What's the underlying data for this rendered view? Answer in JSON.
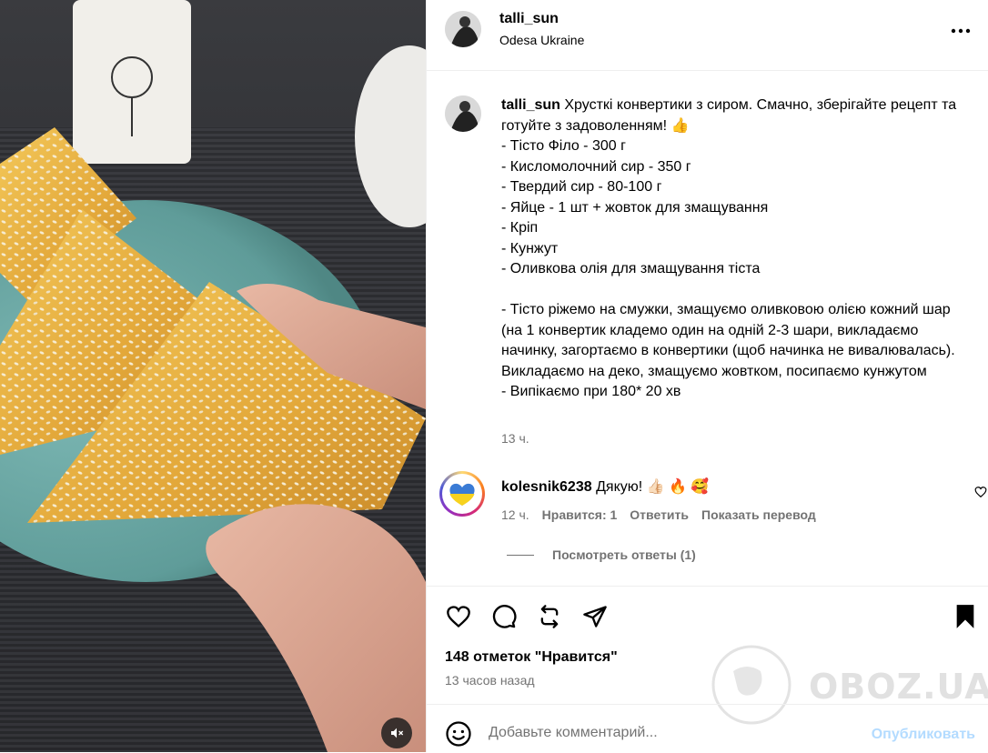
{
  "header": {
    "username": "talli_sun",
    "location": "Odesa Ukraine"
  },
  "caption": {
    "username": "talli_sun",
    "text": "Хрусткі конвертики з сиром. Смачно, зберігайте рецепт та готуйте з задоволенням! 👍\n- Тісто Філо - 300 г\n- Кисломолочний сир - 350 г\n- Твердий сир - 80-100 г\n- Яйце - 1 шт + жовток для змащування\n- Кріп\n- Кунжут\n- Оливкова олія для змащування тіста\n\n- Тісто ріжемо на смужки, змащуємо оливковою олією кожний шар (на 1 конвертик кладемо один на одній 2-3 шари, викладаємо начинку, загортаємо в конвертики (щоб начинка не вивалювалась). Викладаємо на деко, змащуємо жовтком, посипаємо кунжутом\n- Випікаємо при 180* 20 хв",
    "time": "13 ч."
  },
  "comment": {
    "username": "kolesnik6238",
    "text": "Дякую! 👍🏻 🔥 🥰",
    "time": "12 ч.",
    "likes": "Нравится: 1",
    "reply": "Ответить",
    "translate": "Показать перевод",
    "view_replies": "Посмотреть ответы (1)"
  },
  "post": {
    "likes": "148 отметок \"Нравится\"",
    "time": "13 часов назад"
  },
  "composer": {
    "placeholder": "Добавьте комментарий...",
    "publish": "Опубликовать"
  },
  "watermark": {
    "text": "OBOZ.UA"
  },
  "colors": {
    "muted": "#737373",
    "divider": "#efefef",
    "publish_disabled": "#b3dbff",
    "plate": "#6fa9a6"
  },
  "icons": {
    "more": "more-horizontal-icon",
    "heart": "heart-icon",
    "comment": "comment-icon",
    "repost": "repost-icon",
    "share": "share-icon",
    "save": "bookmark-icon",
    "emoji": "emoji-icon",
    "mute": "volume-muted-icon"
  }
}
